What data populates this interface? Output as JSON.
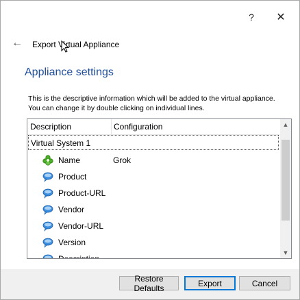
{
  "titlebar": {
    "help_label": "?",
    "close_label": "✕"
  },
  "wizard": {
    "back_label": "←",
    "title": "Export Virtual Appliance"
  },
  "section": {
    "heading": "Appliance settings",
    "description_line1": "This is the descriptive information which will be added to the virtual appliance.",
    "description_line2": "You can change it by double clicking on individual lines."
  },
  "table": {
    "columns": [
      "Description",
      "Configuration"
    ],
    "group": "Virtual System 1",
    "rows": [
      {
        "label": "Name",
        "value": "Grok",
        "icon": "name-icon"
      },
      {
        "label": "Product",
        "value": "",
        "icon": "speech-bubble-icon"
      },
      {
        "label": "Product-URL",
        "value": "",
        "icon": "speech-bubble-icon"
      },
      {
        "label": "Vendor",
        "value": "",
        "icon": "speech-bubble-icon"
      },
      {
        "label": "Vendor-URL",
        "value": "",
        "icon": "speech-bubble-icon"
      },
      {
        "label": "Version",
        "value": "",
        "icon": "speech-bubble-icon"
      },
      {
        "label": "Description",
        "value": "",
        "icon": "speech-bubble-icon"
      }
    ]
  },
  "buttons": {
    "restore_defaults": "Restore Defaults",
    "export": "Export",
    "cancel": "Cancel"
  },
  "colors": {
    "heading": "#1f4e9c",
    "accent": "#0078d7"
  }
}
